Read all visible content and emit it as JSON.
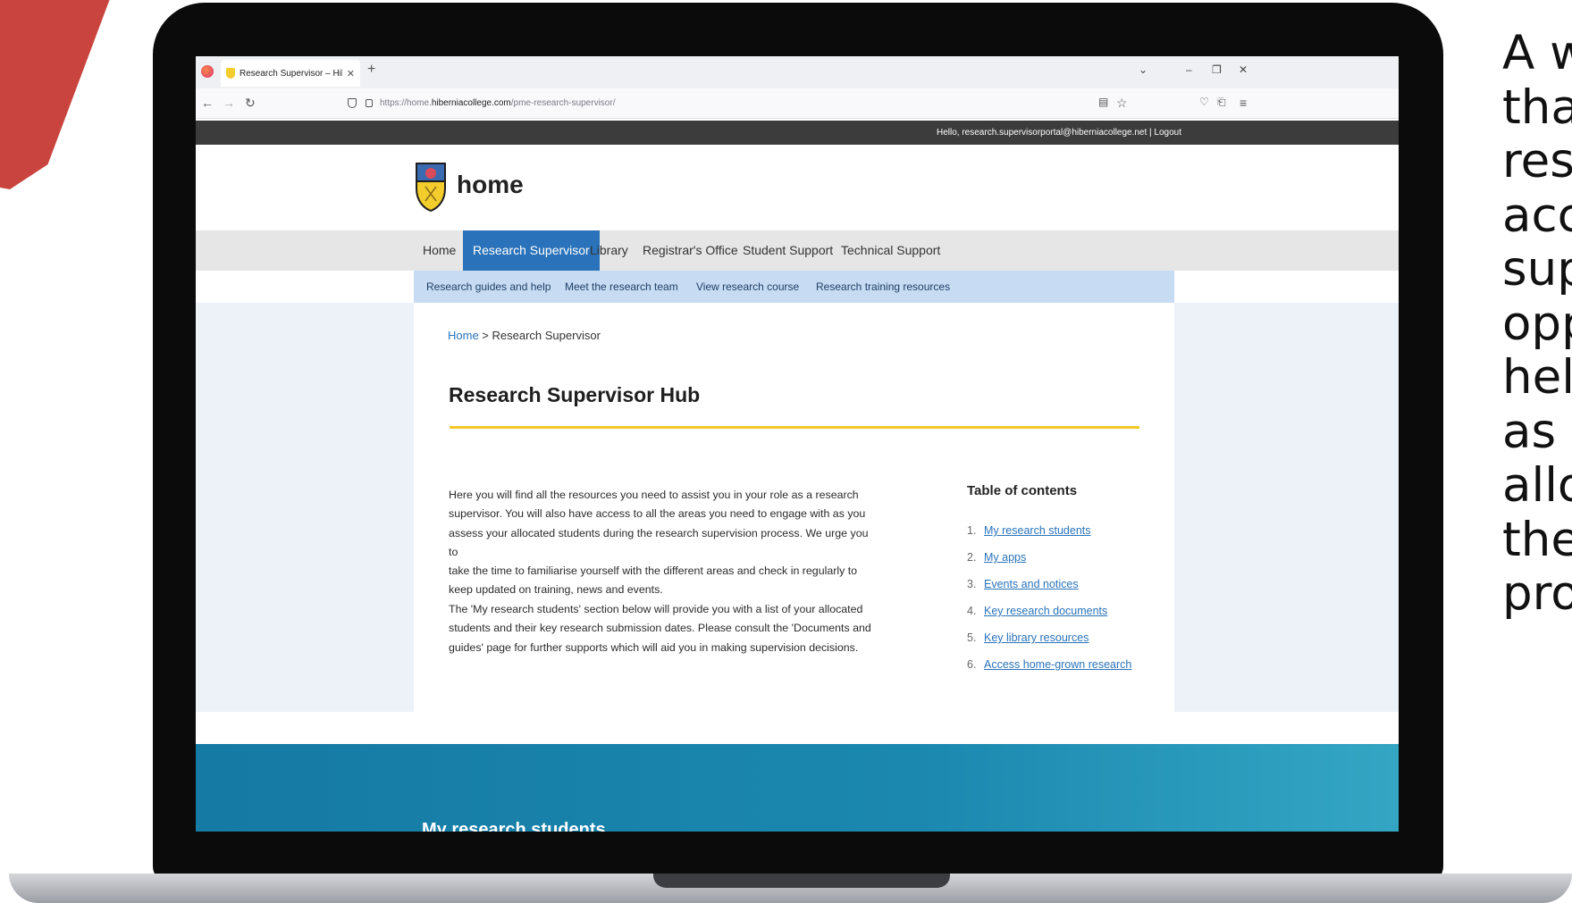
{
  "browser": {
    "tab_title": "Research Supervisor – Hibernia",
    "url_prefix": "https://home.",
    "url_host": "hiberniacollege.com",
    "url_path": "/pme-research-supervisor/"
  },
  "site": {
    "greeting": "Hello, research.supervisorportal@hiberniacollege.net | Logout",
    "brand": "home",
    "main_nav": [
      "Home",
      "Research Supervisor",
      "Library",
      "Registrar's Office",
      "Student Support",
      "Technical Support"
    ],
    "active_nav": "Research Supervisor",
    "sub_nav": [
      "Research guides and help",
      "Meet the research team",
      "View research course",
      "Research training resources"
    ],
    "breadcrumb": {
      "home": "Home",
      "separator": " > ",
      "current": "Research Supervisor"
    },
    "page_title": "Research Supervisor Hub",
    "paragraphs": [
      [
        "Here you will find all the resources you need to assist you in your role as a research",
        "supervisor. You will also have access to all the areas you need to engage with as you",
        "assess your allocated students during the research supervision process. We urge you to",
        "take the time to familiarise yourself with the different areas and check in regularly to",
        "keep updated on training, news and events."
      ],
      [
        "The 'My research students' section below will provide you with a list of your allocated",
        "students and their key research submission dates. Please consult the 'Documents and",
        "guides' page for further supports which will aid you in making supervision decisions."
      ]
    ],
    "toc": {
      "title": "Table of contents",
      "items": [
        {
          "num": "1.",
          "label": "My research students"
        },
        {
          "num": "2.",
          "label": "My apps"
        },
        {
          "num": "3.",
          "label": "Events and notices"
        },
        {
          "num": "4.",
          "label": "Key research documents"
        },
        {
          "num": "5.",
          "label": "Key library resources"
        },
        {
          "num": "6.",
          "label": "Access home-grown research"
        }
      ]
    },
    "footer_partial_heading": "My research students"
  },
  "side_text_lines": [
    "A w",
    "tha",
    "res",
    "acc",
    "sup",
    "opp",
    "hel",
    "as",
    "allo",
    "the",
    "pro"
  ],
  "colors": {
    "accent_red": "#c9443f",
    "nav_active": "#2a73ba",
    "subnav_bg": "#c7dbf3",
    "rule_yellow": "#f2c829",
    "footer_teal": "#157aa4"
  }
}
